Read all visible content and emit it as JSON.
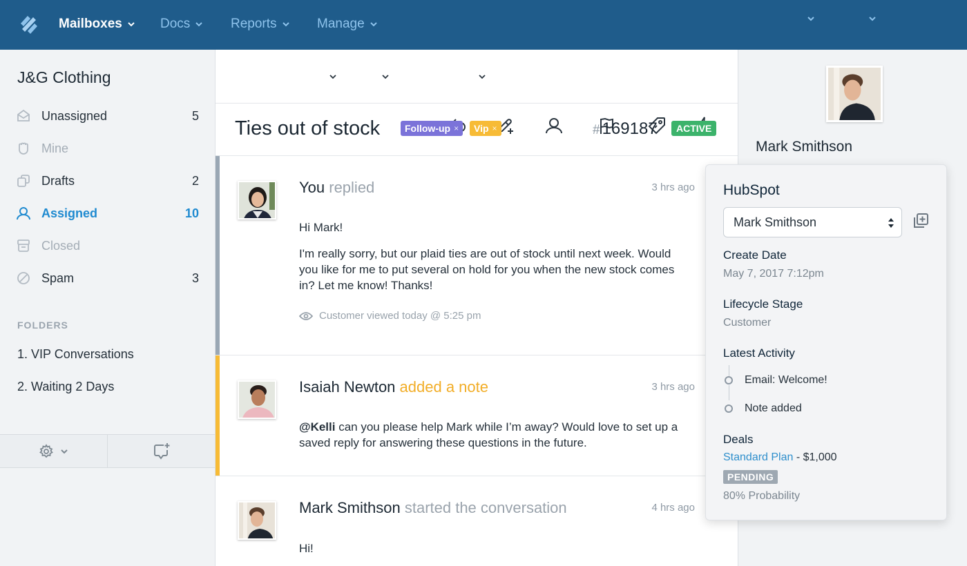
{
  "topnav": {
    "menus": [
      {
        "label": "Mailboxes",
        "active": true
      },
      {
        "label": "Docs",
        "active": false
      },
      {
        "label": "Reports",
        "active": false
      },
      {
        "label": "Manage",
        "active": false
      }
    ],
    "icons": [
      "bell-icon",
      "help-lifebuoy-icon",
      "account-icon",
      "search-icon"
    ]
  },
  "sidebar": {
    "mailbox_name": "J&G Clothing",
    "items": [
      {
        "label": "Unassigned",
        "count": "5",
        "icon": "open-envelope-icon"
      },
      {
        "label": "Mine",
        "count": "",
        "icon": "hand-icon"
      },
      {
        "label": "Drafts",
        "count": "2",
        "icon": "drafts-icon"
      },
      {
        "label": "Assigned",
        "count": "10",
        "icon": "user-icon"
      },
      {
        "label": "Closed",
        "count": "",
        "icon": "archive-icon"
      },
      {
        "label": "Spam",
        "count": "3",
        "icon": "spam-icon"
      }
    ],
    "folders_heading": "FOLDERS",
    "folders": [
      "1. VIP Conversations",
      "2. Waiting 2 Days"
    ]
  },
  "toolbar": {
    "actions": [
      "reply",
      "add-note",
      "assign",
      "status-flag",
      "tag",
      "workflow",
      "more",
      "previous",
      "next"
    ]
  },
  "conversation": {
    "subject": "Ties out of stock",
    "tags": [
      {
        "label": "Follow-up",
        "remove": "×",
        "color": "#7b73d9"
      },
      {
        "label": "Vip",
        "remove": "×",
        "color": "#f7bb36"
      }
    ],
    "ticket_hash": "#",
    "ticket_number": "169187",
    "status": "ACTIVE",
    "status_color": "#3cb36b",
    "threads": [
      {
        "author": "You",
        "action": "replied",
        "time": "3 hrs ago",
        "body": [
          "Hi Mark!",
          "I'm really sorry, but our plaid ties are out of stock until next week. Would you like for me to put several on hold for you when the new stock comes in? Let me know! Thanks!"
        ],
        "viewed": "Customer viewed today @ 5:25 pm",
        "bar_color": "#9aa7b4"
      },
      {
        "author": "Isaiah Newton",
        "action": "added a note",
        "time": "3 hrs ago",
        "mention": "@Kelli",
        "body": " can you please help Mark while I’m away? Would love to set up a saved reply for answering these questions in the future.",
        "bar_color": "#f7bb36"
      },
      {
        "author": "Mark Smithson",
        "action": "started the conversation",
        "time": "4 hrs ago",
        "body": [
          "Hi!"
        ]
      }
    ]
  },
  "customer": {
    "name": "Mark Smithson"
  },
  "hubspot": {
    "title": "HubSpot",
    "selected_contact": "Mark Smithson",
    "create_date_label": "Create Date",
    "create_date": "May 7, 2017 7:12pm",
    "lifecycle_label": "Lifecycle Stage",
    "lifecycle": "Customer",
    "activity_label": "Latest Activity",
    "activities": [
      "Email: Welcome!",
      "Note added"
    ],
    "deals_label": "Deals",
    "deal_name": "Standard Plan",
    "deal_amount": " - $1,000",
    "deal_status": "PENDING",
    "deal_probability": "80% Probability"
  }
}
